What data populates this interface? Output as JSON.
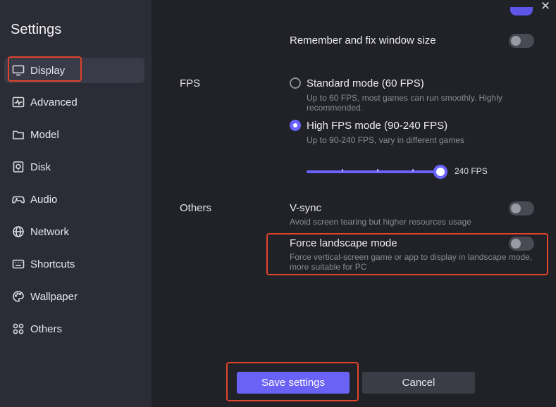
{
  "sidebar": {
    "title": "Settings",
    "items": [
      {
        "label": "Display",
        "icon": "monitor-icon"
      },
      {
        "label": "Advanced",
        "icon": "pulse-icon"
      },
      {
        "label": "Model",
        "icon": "folder-icon"
      },
      {
        "label": "Disk",
        "icon": "disk-icon"
      },
      {
        "label": "Audio",
        "icon": "gamepad-icon"
      },
      {
        "label": "Network",
        "icon": "globe-icon"
      },
      {
        "label": "Shortcuts",
        "icon": "keyboard-icon"
      },
      {
        "label": "Wallpaper",
        "icon": "palette-icon"
      },
      {
        "label": "Others",
        "icon": "grid-icon"
      }
    ],
    "active": "Display"
  },
  "window": {
    "close_glyph": "✕"
  },
  "display": {
    "remember_window": {
      "label": "Remember and fix window size",
      "enabled": false
    },
    "fps": {
      "section_label": "FPS",
      "standard": {
        "label": "Standard mode (60 FPS)",
        "desc": "Up to 60 FPS, most games can run smoothly. Highly recommended.",
        "selected": false
      },
      "high": {
        "label": "High FPS mode (90-240 FPS)",
        "desc": "Up to 90-240 FPS, vary in different games",
        "selected": true
      },
      "slider": {
        "value": 240,
        "min": 90,
        "max": 240,
        "value_label": "240 FPS"
      }
    },
    "others": {
      "section_label": "Others",
      "vsync": {
        "label": "V-sync",
        "desc": "Avoid screen tearing but higher resources usage",
        "enabled": false
      },
      "force_landscape": {
        "label": "Force landscape mode",
        "desc": "Force vertical-screen game or app to display in landscape mode, more suitable for PC",
        "enabled": false
      }
    }
  },
  "footer": {
    "save_label": "Save settings",
    "cancel_label": "Cancel"
  },
  "colors": {
    "accent": "#6b63ff",
    "highlight": "#e0442b",
    "sidebar_bg": "#2c2c36",
    "main_bg": "#212128"
  }
}
